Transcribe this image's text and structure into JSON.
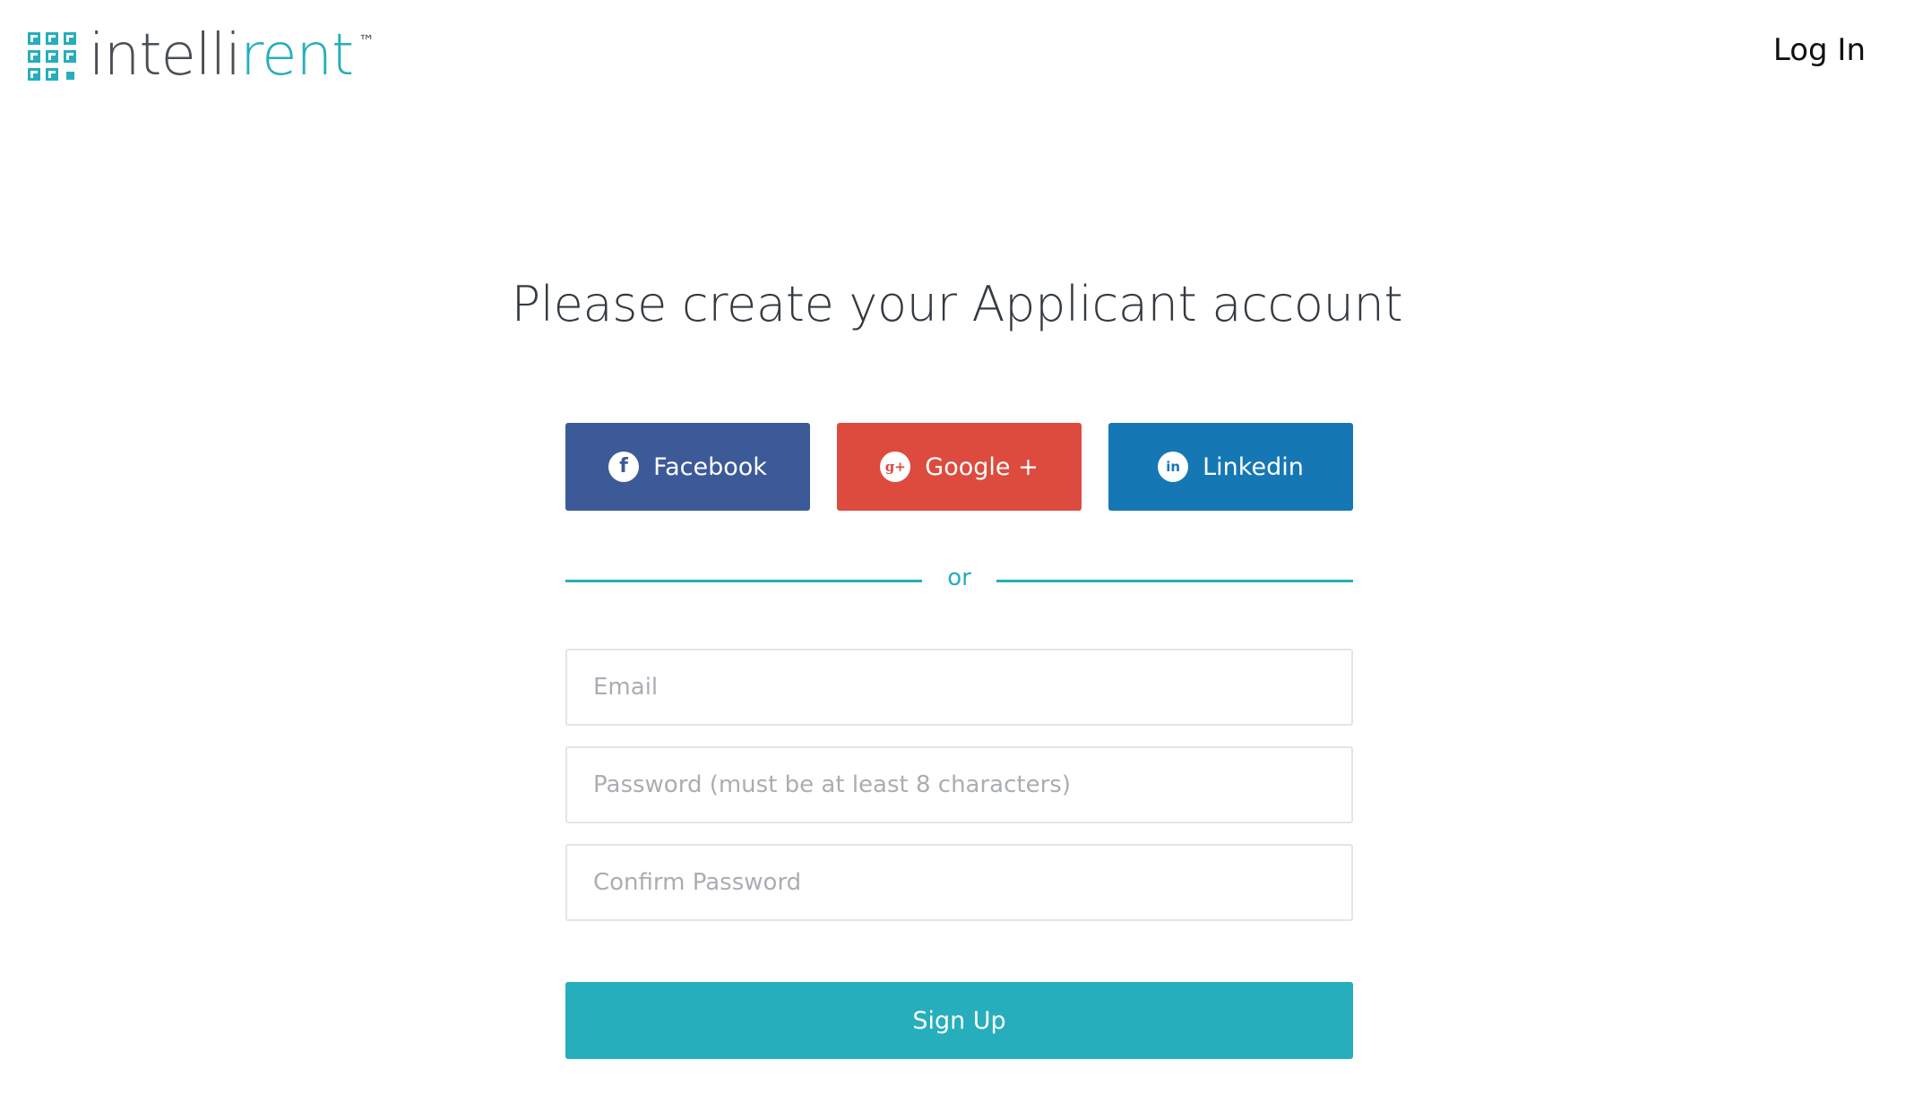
{
  "header": {
    "logo": {
      "text_dark": "intelli",
      "text_accent": "rent",
      "trademark": "™"
    },
    "login_label": "Log In"
  },
  "main": {
    "title": "Please create your Applicant account",
    "social": {
      "facebook": {
        "label": "Facebook",
        "icon": "facebook-icon",
        "glyph": "f",
        "color": "#3d5a98"
      },
      "google": {
        "label": "Google +",
        "icon": "google-plus-icon",
        "glyph": "g+",
        "color": "#dd4b3e"
      },
      "linkedin": {
        "label": "Linkedin",
        "icon": "linkedin-icon",
        "glyph": "in",
        "color": "#1677b5"
      }
    },
    "divider_text": "or",
    "form": {
      "email_placeholder": "Email",
      "email_value": "",
      "password_placeholder": "Password (must be at least 8 characters)",
      "password_value": "",
      "confirm_placeholder": "Confirm Password",
      "confirm_value": "",
      "submit_label": "Sign Up"
    }
  },
  "colors": {
    "accent": "#26aebc",
    "text_dark": "#333a40"
  }
}
